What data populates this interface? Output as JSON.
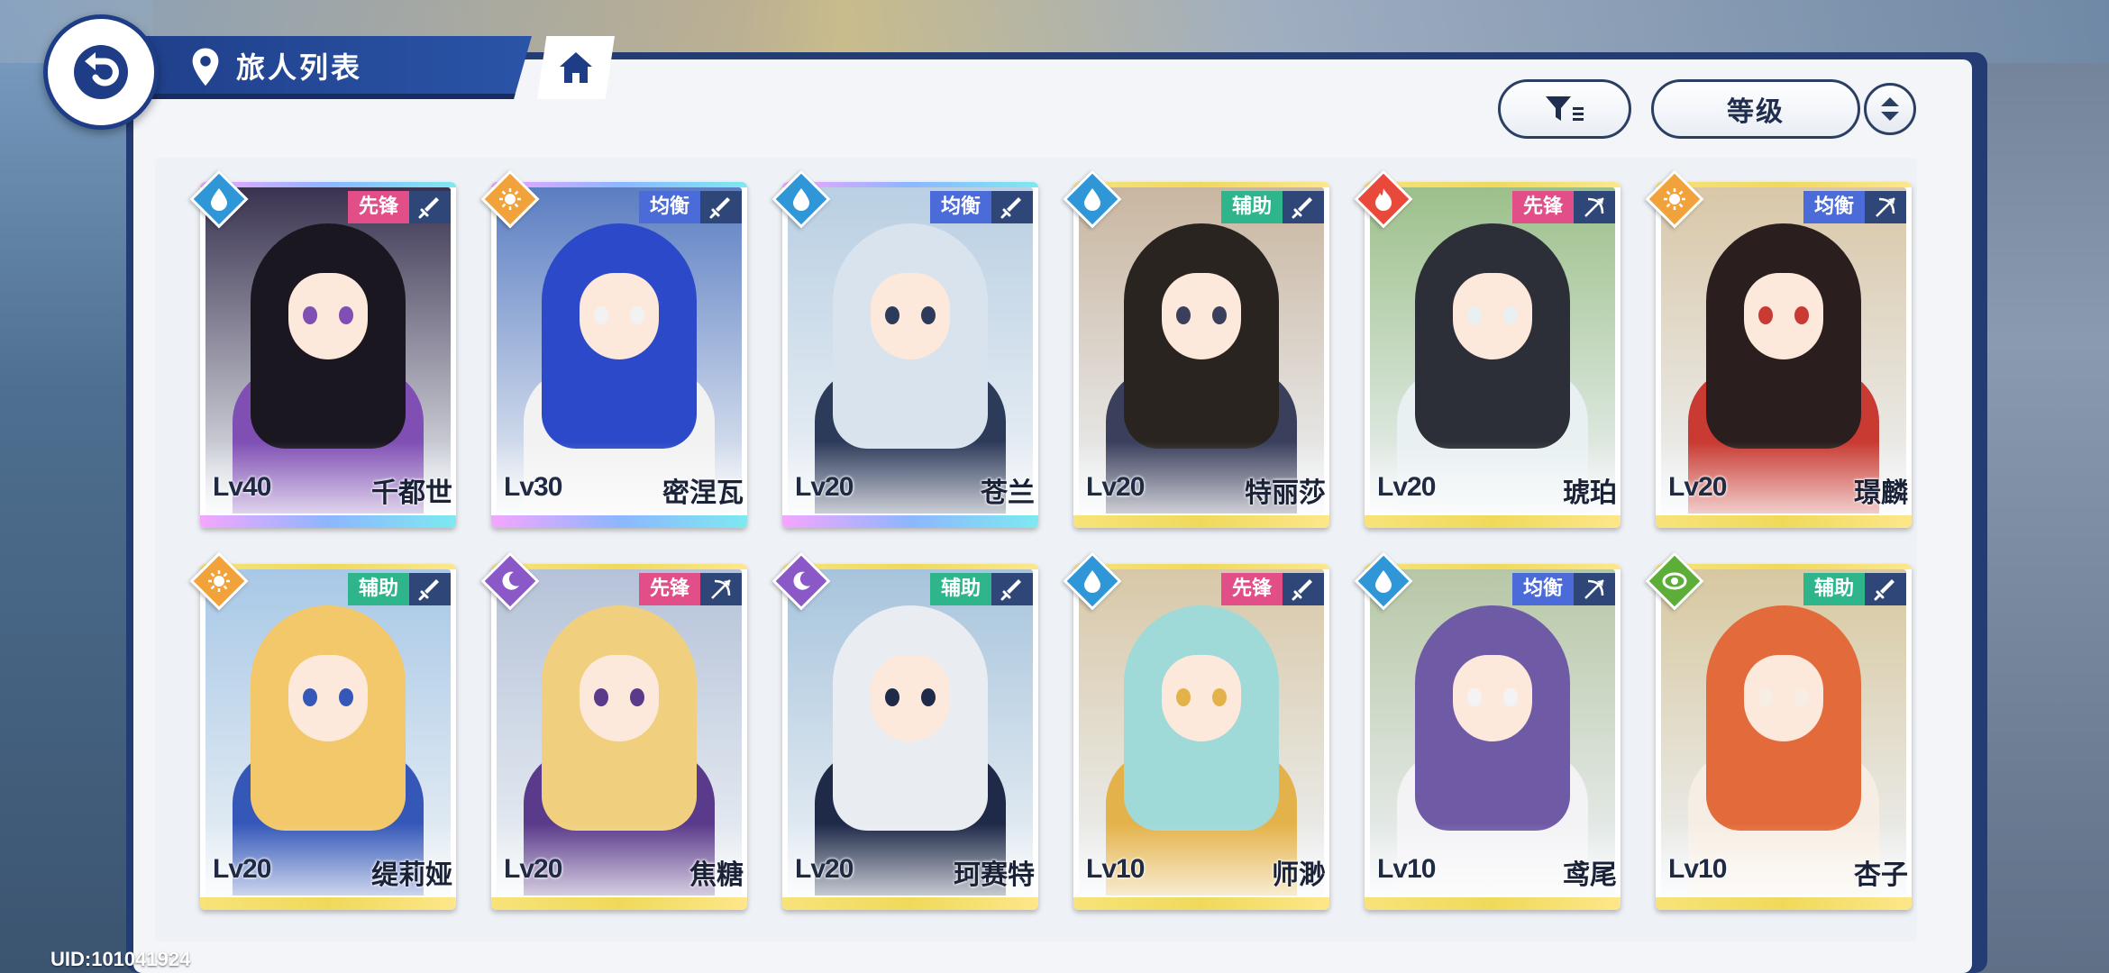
{
  "header": {
    "title": "旅人列表"
  },
  "toolbar": {
    "sort_label": "等级"
  },
  "footer": {
    "uid": "UID:101041924"
  },
  "cards": [
    {
      "level": "Lv40",
      "name": "千都世",
      "role": "先锋",
      "role_color": "#e24f88",
      "element": "water",
      "weapon": "sword",
      "rarity": "ssr",
      "palette": [
        "#3a3350",
        "#1b1720",
        "#7f4fb4"
      ]
    },
    {
      "level": "Lv30",
      "name": "密涅瓦",
      "role": "均衡",
      "role_color": "#4a6bd8",
      "element": "light",
      "weapon": "sword",
      "rarity": "ssr",
      "palette": [
        "#5b7ec2",
        "#2b49c8",
        "#f2f2f2"
      ]
    },
    {
      "level": "Lv20",
      "name": "苍兰",
      "role": "均衡",
      "role_color": "#4a6bd8",
      "element": "water",
      "weapon": "sword",
      "rarity": "ssr",
      "palette": [
        "#b9cfe3",
        "#d9e3ee",
        "#2d3b5a"
      ]
    },
    {
      "level": "Lv20",
      "name": "特丽莎",
      "role": "辅助",
      "role_color": "#2fb58c",
      "element": "water",
      "weapon": "sword",
      "rarity": "sr",
      "palette": [
        "#c9b6a0",
        "#2a2420",
        "#3a3f5c"
      ]
    },
    {
      "level": "Lv20",
      "name": "琥珀",
      "role": "先锋",
      "role_color": "#e24f88",
      "element": "fire",
      "weapon": "bow",
      "rarity": "sr",
      "palette": [
        "#9cc08a",
        "#2d2f38",
        "#e8f0f2"
      ]
    },
    {
      "level": "Lv20",
      "name": "璟麟",
      "role": "均衡",
      "role_color": "#4a6bd8",
      "element": "light",
      "weapon": "bow",
      "rarity": "sr",
      "palette": [
        "#d9c7a8",
        "#2a1e1e",
        "#c83a32"
      ]
    },
    {
      "level": "Lv20",
      "name": "缇莉娅",
      "role": "辅助",
      "role_color": "#2fb58c",
      "element": "light",
      "weapon": "sword",
      "rarity": "sr",
      "palette": [
        "#a8c8e6",
        "#f2c86a",
        "#3558b8"
      ]
    },
    {
      "level": "Lv20",
      "name": "焦糖",
      "role": "先锋",
      "role_color": "#e24f88",
      "element": "dark",
      "weapon": "bow",
      "rarity": "sr",
      "palette": [
        "#b5c2d8",
        "#f0d07e",
        "#5a3a8a"
      ]
    },
    {
      "level": "Lv20",
      "name": "珂赛特",
      "role": "辅助",
      "role_color": "#2fb58c",
      "element": "dark",
      "weapon": "sword",
      "rarity": "sr",
      "palette": [
        "#a7c4dc",
        "#e9edf2",
        "#1e2a48"
      ]
    },
    {
      "level": "Lv10",
      "name": "师渺",
      "role": "先锋",
      "role_color": "#e24f88",
      "element": "water",
      "weapon": "sword",
      "rarity": "sr",
      "palette": [
        "#d8c8a8",
        "#9fd9d8",
        "#e4b24a"
      ]
    },
    {
      "level": "Lv10",
      "name": "鸢尾",
      "role": "均衡",
      "role_color": "#4a6bd8",
      "element": "water",
      "weapon": "bow",
      "rarity": "sr",
      "palette": [
        "#b7c7a6",
        "#6f5aa6",
        "#f3f3f6"
      ]
    },
    {
      "level": "Lv10",
      "name": "杏子",
      "role": "辅助",
      "role_color": "#2fb58c",
      "element": "wind",
      "weapon": "sword",
      "rarity": "sr",
      "palette": [
        "#d7c8a0",
        "#e36a3a",
        "#f6eee4"
      ]
    }
  ],
  "colors": {
    "water": "#2f96d8",
    "light": "#f1a23a",
    "fire": "#e8493a",
    "dark": "#8b59c7",
    "wind": "#5cae38",
    "rarity_ssr": "linear-gradient(90deg,#f4a6ff,#8db6ff,#7de9f0)",
    "rarity_sr": "linear-gradient(90deg,#f7e37a,#f0d95a,#fde78a)"
  }
}
